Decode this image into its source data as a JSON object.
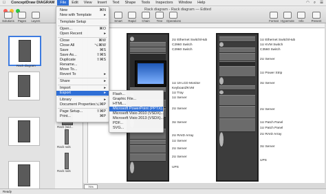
{
  "menubar": {
    "app_name": "ConceptDraw DIAGRAM",
    "items": [
      "File",
      "Edit",
      "View",
      "Insert",
      "Text",
      "Shape",
      "Tools",
      "Inspectors",
      "Window",
      "Help"
    ],
    "active": "File"
  },
  "window": {
    "title": "Rack diagram - Rack diagram — Edited"
  },
  "toolbar": {
    "left": [
      "Solutions",
      "Pages",
      "Layers"
    ],
    "middle": [
      "Smart",
      "Rapid Draw",
      "Chain",
      "Tree",
      "Operations"
    ],
    "right": [
      "Format",
      "Hypernote",
      "Info",
      "Present"
    ]
  },
  "file_menu": {
    "items": [
      {
        "label": "New",
        "shortcut": "⌘N"
      },
      {
        "label": "New with Template",
        "shortcut": "▸"
      },
      {
        "sep": true
      },
      {
        "label": "Template Setup",
        "shortcut": ""
      },
      {
        "sep": true
      },
      {
        "label": "Open...",
        "shortcut": "⌘O"
      },
      {
        "label": "Open Recent",
        "shortcut": "▸"
      },
      {
        "sep": true
      },
      {
        "label": "Close",
        "shortcut": "⌘W"
      },
      {
        "label": "Close All",
        "shortcut": "⌥⌘W"
      },
      {
        "label": "Save",
        "shortcut": "⌘S"
      },
      {
        "label": "Save As...",
        "shortcut": "⇧⌘S"
      },
      {
        "label": "Duplicate",
        "shortcut": "⇧⌘S"
      },
      {
        "label": "Rename...",
        "shortcut": ""
      },
      {
        "label": "Move To...",
        "shortcut": ""
      },
      {
        "label": "Revert To",
        "shortcut": "▸"
      },
      {
        "sep": true
      },
      {
        "label": "Share",
        "shortcut": "▸"
      },
      {
        "sep": true
      },
      {
        "label": "Import",
        "shortcut": "▸"
      },
      {
        "label": "Export",
        "shortcut": "▸",
        "highlight": true
      },
      {
        "sep": true
      },
      {
        "label": "Library",
        "shortcut": "▸"
      },
      {
        "label": "Document Properties...",
        "shortcut": "⌥⌘P"
      },
      {
        "sep": true
      },
      {
        "label": "Page Setup...",
        "shortcut": "⇧⌘P"
      },
      {
        "label": "Print...",
        "shortcut": "⌘P"
      }
    ]
  },
  "export_menu": {
    "items": [
      {
        "label": "Flash..."
      },
      {
        "label": "Graphic File..."
      },
      {
        "label": "HTML..."
      },
      {
        "label": "Microsoft PowerPoint (PPTX)...",
        "highlight": true
      },
      {
        "label": "Microsoft Visio 2010 (VSDX)..."
      },
      {
        "label": "Microsoft Visio 2013 (VSDX)..."
      },
      {
        "label": "PDF..."
      },
      {
        "label": "SVG..."
      }
    ]
  },
  "left_panel": {
    "thumb_label": "Rack diagram"
  },
  "library": {
    "labels": [
      "Rack (wid...",
      "Rack rails",
      "Rack rails"
    ]
  },
  "rack_labels_left": [
    "2U Ethernet Switch/Hub",
    "C2960 Switch",
    "C2960 Switch",
    "1U 19 LCD Monitor",
    "Keyboard/KVM",
    "1U Tray",
    "1U Server",
    "2U Server",
    "3U Server",
    "2U RAID Array",
    "1U Server",
    "2U Server",
    "2U Server",
    "UPS"
  ],
  "rack_labels_right": [
    "1U Ethernet Switch/Hub",
    "1U KVM Switch",
    "C3560 Switch",
    "2U Server",
    "1U Power Strip",
    "3U Server",
    "2U Server",
    "1U Patch Panel",
    "1U Patch Panel",
    "2U RAID Array",
    "3U Server",
    "UPS"
  ],
  "status": {
    "text": "Ready",
    "zoom": "75%"
  },
  "colors": {
    "menu_highlight": "#2f6fd6",
    "rack_body": "#3c3c3c"
  }
}
